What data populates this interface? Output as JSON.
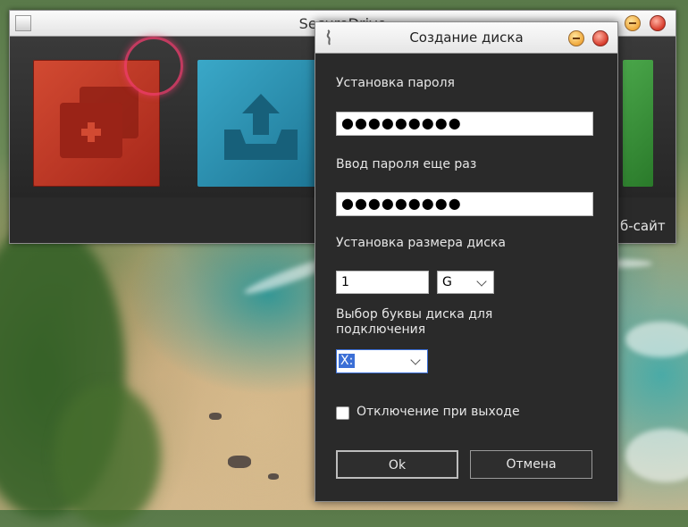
{
  "main_window": {
    "title": "SecureDrive",
    "website_label": "б-сайт"
  },
  "dialog": {
    "title": "Создание диска",
    "password_label": "Установка пароля",
    "password_value": "●●●●●●●●●",
    "password_repeat_label": "Ввод пароля еще раз",
    "password_repeat_value": "●●●●●●●●●",
    "size_label": "Установка размера диска",
    "size_value": "1",
    "size_unit": "G",
    "drive_letter_label_line1": "Выбор буквы диска для",
    "drive_letter_label_line2": "подключения",
    "drive_letter_value": "X:",
    "unmount_checkbox_label": "Отключение при выходе",
    "unmount_checked": false,
    "ok_label": "Ok",
    "cancel_label": "Отмена"
  },
  "colors": {
    "tile_red": "#c43a26",
    "tile_blue": "#2a8fb0",
    "tile_green": "#3a8f3a",
    "dialog_bg": "#2a2a2a",
    "selection": "#3b6fd6"
  }
}
